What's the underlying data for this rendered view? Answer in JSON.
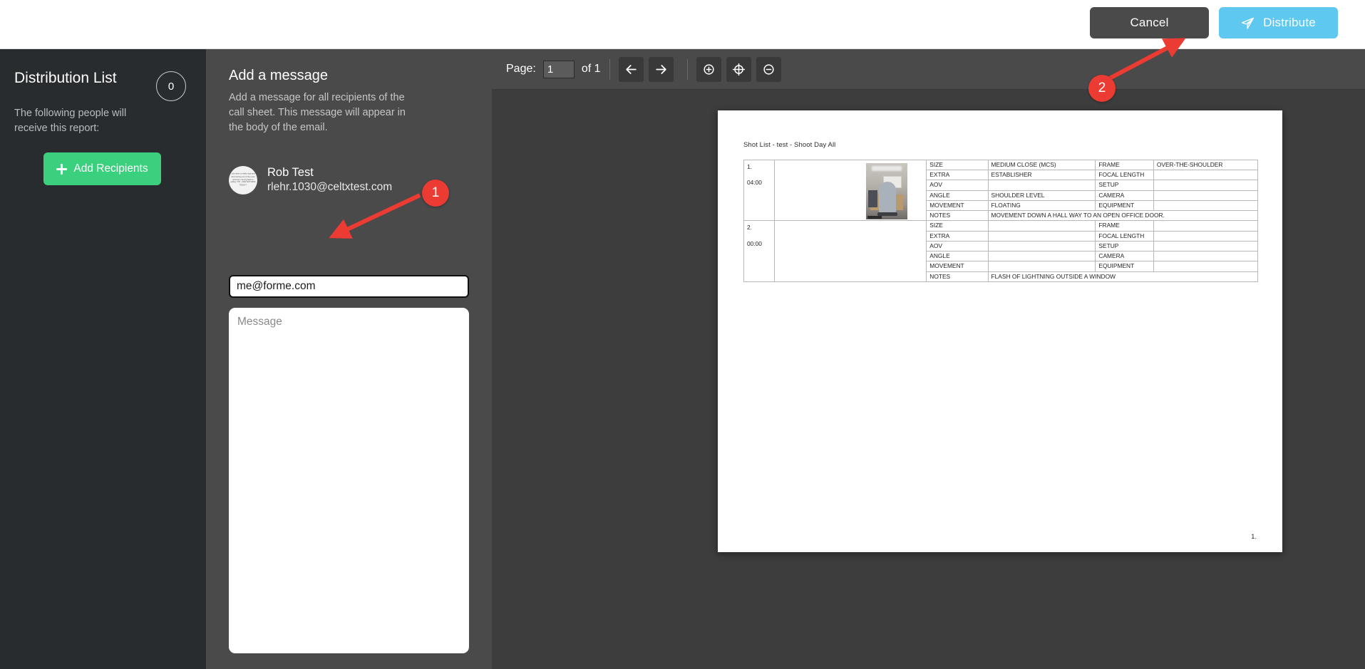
{
  "header": {
    "cancel_label": "Cancel",
    "distribute_label": "Distribute",
    "distribute_icon": "send-icon",
    "distribute_color": "#5ec8f0"
  },
  "distribution_panel": {
    "title": "Distribution List",
    "subtitle": "The following people will receive this report:",
    "count": "0",
    "add_recipients_label": "Add Recipients",
    "add_recipients_color": "#3bd07d",
    "add_icon": "plus-icon"
  },
  "message_panel": {
    "title": "Add a message",
    "description": "Add a message for all recipients of the call sheet. This message will appear in the body of the email.",
    "sender": {
      "name": "Rob Test",
      "email": "rlehr.1030@celtxtest.com",
      "avatar_text": "Like when a really mad and tired turning out of the room and then coming back in yelling \"Oh! - AND NOTHING TODAY!\""
    },
    "recipient_value": "me@forme.com",
    "recipient_placeholder": "",
    "message_placeholder": "Message"
  },
  "viewer": {
    "page_label": "Page:",
    "page_value": "1",
    "page_of": "of 1",
    "buttons": [
      {
        "name": "previous-page-button",
        "glyph": "←"
      },
      {
        "name": "next-page-button",
        "glyph": "→"
      },
      {
        "name": "zoom-in-button",
        "glyph": "zoom-in-icon"
      },
      {
        "name": "fit-page-button",
        "glyph": "fit-page-icon"
      },
      {
        "name": "zoom-out-button",
        "glyph": "zoom-out-icon"
      }
    ]
  },
  "document": {
    "title": "Shot List - test - Shoot Day All",
    "footer": "1.",
    "shots": [
      {
        "number": "1.",
        "time": "04:00",
        "has_image": true,
        "rows": [
          {
            "key": "SIZE",
            "value": "MEDIUM CLOSE (MCS)",
            "key2": "FRAME",
            "value2": "OVER-THE-SHOULDER"
          },
          {
            "key": "EXTRA",
            "value": "ESTABLISHER",
            "key2": "FOCAL LENGTH",
            "value2": ""
          },
          {
            "key": "AOV",
            "value": "",
            "key2": "SETUP",
            "value2": ""
          },
          {
            "key": "ANGLE",
            "value": "SHOULDER LEVEL",
            "key2": "CAMERA",
            "value2": ""
          },
          {
            "key": "MOVEMENT",
            "value": "FLOATING",
            "key2": "EQUIPMENT",
            "value2": ""
          }
        ],
        "notes_key": "NOTES",
        "notes": "MOVEMENT DOWN A HALL WAY TO AN OPEN OFFICE DOOR."
      },
      {
        "number": "2.",
        "time": "00:00",
        "has_image": false,
        "rows": [
          {
            "key": "SIZE",
            "value": "",
            "key2": "FRAME",
            "value2": ""
          },
          {
            "key": "EXTRA",
            "value": "",
            "key2": "FOCAL LENGTH",
            "value2": ""
          },
          {
            "key": "AOV",
            "value": "",
            "key2": "SETUP",
            "value2": ""
          },
          {
            "key": "ANGLE",
            "value": "",
            "key2": "CAMERA",
            "value2": ""
          },
          {
            "key": "MOVEMENT",
            "value": "",
            "key2": "EQUIPMENT",
            "value2": ""
          }
        ],
        "notes_key": "NOTES",
        "notes": "FLASH OF LIGHTNING OUTSIDE A WINDOW"
      }
    ]
  },
  "annotations": {
    "marker_color": "#eb3b33",
    "markers": [
      {
        "label": "1"
      },
      {
        "label": "2"
      }
    ]
  }
}
